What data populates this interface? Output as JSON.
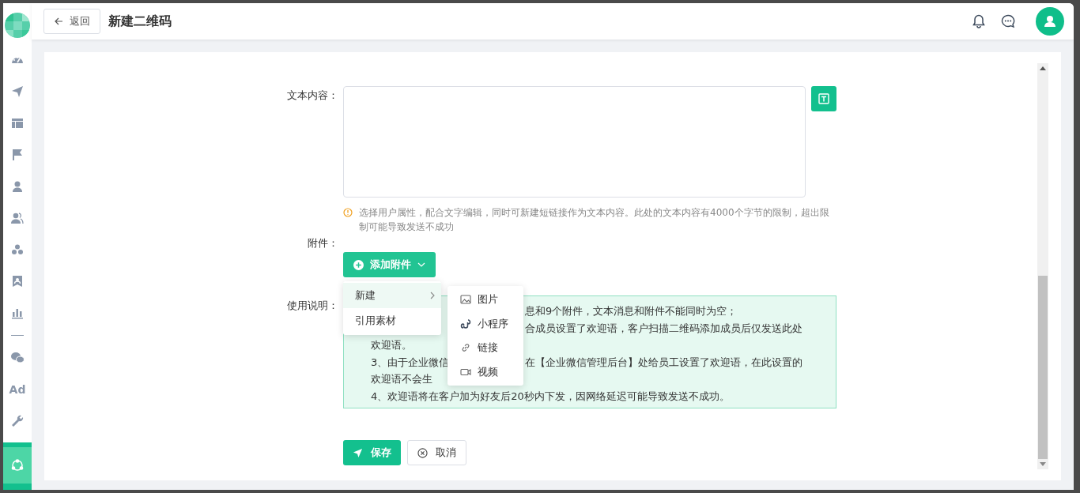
{
  "sidebar": {
    "items": [
      {
        "kind": "icon",
        "selected": false
      },
      {
        "kind": "icon",
        "selected": false
      },
      {
        "kind": "icon",
        "selected": false
      },
      {
        "kind": "icon",
        "selected": false
      },
      {
        "kind": "icon",
        "selected": false
      },
      {
        "kind": "icon",
        "selected": false
      },
      {
        "kind": "icon",
        "selected": false
      },
      {
        "kind": "icon",
        "selected": false
      },
      {
        "kind": "icon",
        "selected": false
      },
      {
        "kind": "divider"
      },
      {
        "kind": "icon",
        "selected": false
      },
      {
        "kind": "text",
        "label": "Ad",
        "selected": false
      },
      {
        "kind": "icon",
        "selected": false
      },
      {
        "kind": "icon",
        "selected": true
      }
    ]
  },
  "header": {
    "back_button": "返回",
    "title": "新建二维码"
  },
  "form": {
    "text_content": {
      "label": "文本内容：",
      "hint": "选择用户属性，配合文字编辑，同时可新建短链接作为文本内容。此处的文本内容有4000个字节的限制，超出限制可能导致发送不成功"
    },
    "attachment": {
      "label": "附件：",
      "button": "添加附件"
    },
    "usage": {
      "label": "使用说明：",
      "lines": [
        {
          "segments": [
            {
              "kind": "tail",
              "text": "息和9个附件，文本消息和附件不能同时为空；"
            }
          ]
        },
        {
          "segments": [
            {
              "kind": "tail",
              "text": "合成员设置了欢迎语，客户扫描二维码添加成员后仅发送此处"
            }
          ]
        },
        {
          "segments": [
            {
              "kind": "full",
              "text": "欢迎语。"
            }
          ]
        },
        {
          "segments": [
            {
              "kind": "lead",
              "text": "3、由于企业微信"
            },
            {
              "kind": "tail",
              "text": "在【企业微信管理后台】处给员工设置了欢迎语，在此设置的"
            }
          ]
        },
        {
          "segments": [
            {
              "kind": "lead",
              "text": "欢迎语不会生"
            }
          ]
        },
        {
          "segments": [
            {
              "kind": "full",
              "text": "4、欢迎语将在客户加为好友后20秒内下发，因网络延迟可能导致发送不成功。"
            }
          ]
        }
      ]
    },
    "save_button": "保存",
    "cancel_button": "取消"
  },
  "menu": {
    "items": [
      {
        "label": "新建",
        "hovered": true,
        "submenu": true
      },
      {
        "label": "引用素材",
        "hovered": false,
        "submenu": false
      }
    ],
    "submenu": {
      "items": [
        {
          "label": "图片"
        },
        {
          "label": "小程序"
        },
        {
          "label": "链接"
        },
        {
          "label": "视频"
        }
      ]
    }
  }
}
